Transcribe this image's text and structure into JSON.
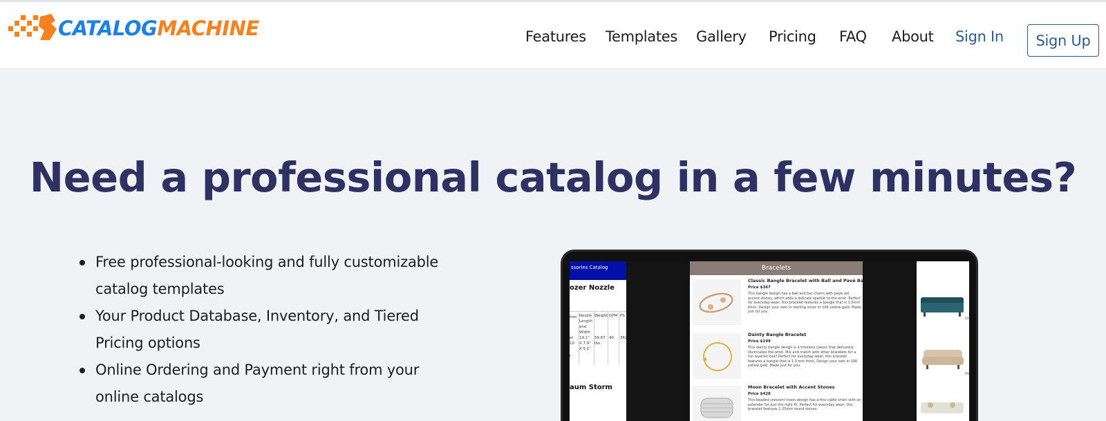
{
  "brand": {
    "word1": "CATALOG",
    "word2": "MACHINE",
    "colors": {
      "blue": "#1d80e3",
      "orange": "#f5821f"
    }
  },
  "nav": {
    "links": [
      "Features",
      "Templates",
      "Gallery",
      "Pricing",
      "FAQ",
      "About"
    ],
    "sign_in": "Sign In",
    "sign_up": "Sign Up"
  },
  "hero": {
    "title": "Need a professional catalog in a few minutes?",
    "features": [
      "Free professional-looking and fully customizable catalog templates",
      "Your Product Database, Inventory, and Tiered Pricing options",
      "Online Ordering and Payment right from your online catalogs"
    ]
  },
  "preview": {
    "left_doc": {
      "bar_text": "ssories Catalog",
      "heading": "ozer Nozzle",
      "cells": [
        "tion",
        "Nozzle Length and Width",
        "Weight",
        "GPM",
        "PS",
        "er 10",
        "19.1\" X 7.9\" X 5.1\"",
        "56.67 lbs.",
        "40",
        "362",
        "r"
      ],
      "heading2": "aum Storm"
    },
    "mid_doc": {
      "header": "Bracelets",
      "products": [
        {
          "title": "Classic Bangle Bracelet with Ball and Pavé Bar Charm",
          "price": "Price $367",
          "desc": "This bangle design has a ball and bar charm with pavé set accent stones, which adds a delicate sparkle to the wrist. Perfect for everyday wear, this bracelet features a bangle that is 1.0mm thick. Design your own in sterling silver or 10K yellow gold. Made just for you."
        },
        {
          "title": "Dainty Bangle Bracelet",
          "price": "Price $199",
          "desc": "This dainty bangle design is a timeless classic that delicately illuminates the wrist. Mix and match with other bracelets for a fun layered look! Perfect for everyday wear, this bracelet features a bangle that is 1.3 mm thick. Design your own in 10K yellow gold. Made just for you."
        },
        {
          "title": "Moon Bracelet with Accent Stones",
          "price": "Price $428",
          "desc": "This beaded crescent moon design has a fine cable chain with an extender for just the right fit. Perfect for everyday wear, this bracelet features 1.25mm round stones."
        }
      ]
    },
    "right_doc": {
      "notes": [
        "Ur",
        "Ho"
      ]
    }
  }
}
